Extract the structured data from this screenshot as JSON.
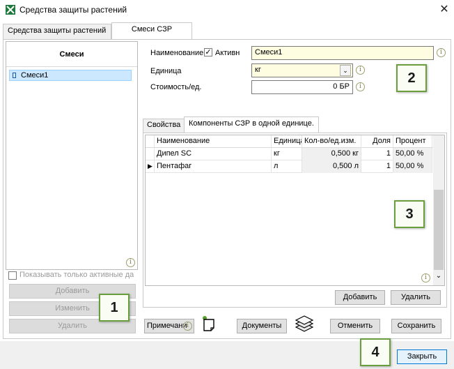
{
  "window": {
    "title": "Средства защиты растений",
    "close_glyph": "✕"
  },
  "main_tabs": [
    {
      "label": "Средства защиты растений"
    },
    {
      "label": "Смеси СЗР"
    }
  ],
  "left_panel": {
    "header": "Смеси",
    "items": [
      {
        "label": "Смеси1"
      }
    ],
    "show_active_only": "Показывать только активные да",
    "buttons": {
      "add": "Добавить",
      "edit": "Изменить",
      "delete": "Удалить"
    }
  },
  "form": {
    "name_label": "Наименование",
    "active_label": "Активн",
    "active_checked": "✓",
    "name_value": "Смеси1",
    "unit_label": "Единица",
    "unit_value": "кг",
    "cost_label": "Стоимость/ед.",
    "cost_value": "0 БР"
  },
  "inner_tabs": [
    {
      "label": "Свойства"
    },
    {
      "label": "Компоненты СЗР в одной единице."
    }
  ],
  "grid": {
    "columns": [
      "Наименование",
      "Единица",
      "Кол-во/ед.изм.",
      "Доля",
      "Процент"
    ],
    "rows": [
      {
        "marker": "",
        "name": "Дипел SC",
        "unit": "кг",
        "qty": "0,500 кг",
        "share": "1",
        "percent": "50,00 %"
      },
      {
        "marker": "▶",
        "name": "Пентафаг",
        "unit": "л",
        "qty": "0,500 л",
        "share": "1",
        "percent": "50,00 %"
      }
    ]
  },
  "grid_buttons": {
    "add": "Добавить",
    "delete": "Удалить"
  },
  "bottom_buttons": {
    "notes": "Примечани",
    "documents": "Документы",
    "cancel": "Отменить",
    "save": "Сохранить",
    "close": "Закрыть"
  },
  "callouts": [
    "1",
    "2",
    "3",
    "4"
  ],
  "icons": {
    "info": "i",
    "dropdown": "⌄",
    "scroll_down": "⌄"
  },
  "colors": {
    "selection": "#cce8ff",
    "input_bg": "#fffde1",
    "callout_border": "#6a9e3c"
  }
}
